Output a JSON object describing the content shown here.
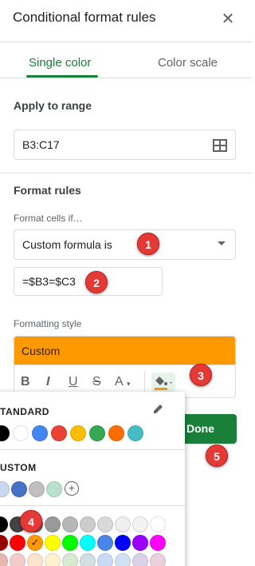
{
  "header": {
    "title": "Conditional format rules",
    "close_icon": "close-icon"
  },
  "tabs": [
    {
      "label": "Single color",
      "active": true
    },
    {
      "label": "Color scale",
      "active": false
    }
  ],
  "range": {
    "label": "Apply to range",
    "value": "B3:C17",
    "icon": "grid-icon"
  },
  "rules": {
    "label": "Format rules",
    "condition_label": "Format cells if…",
    "condition_value": "Custom formula is",
    "formula_value": "=$B3=$C3"
  },
  "style": {
    "label": "Formatting style",
    "preset": "Custom",
    "fill_color": "#ff9900",
    "toolbar": {
      "bold": "B",
      "italic": "I",
      "underline": "U",
      "strike": "S",
      "text_color": "A"
    }
  },
  "done_label": "Done",
  "palette": {
    "standard_label": "TANDARD",
    "custom_label": "USTOM",
    "standard_colors": [
      "#000000",
      "#ffffff",
      "#4285f4",
      "#ea4335",
      "#fbbc04",
      "#34a853",
      "#ff6d01",
      "#46bdc6"
    ],
    "custom_colors": [
      "#c9d7f0",
      "#4472c4",
      "#bfbfbf",
      "#b7e1cd"
    ],
    "grid_row1": [
      "#000000",
      "#434343",
      "#666666",
      "#999999",
      "#b7b7b7",
      "#cccccc",
      "#d9d9d9",
      "#efefef",
      "#f3f3f3",
      "#ffffff"
    ],
    "grid_row2": [
      "#980000",
      "#ff0000",
      "#ff9900",
      "#ffff00",
      "#00ff00",
      "#00ffff",
      "#4a86e8",
      "#0000ff",
      "#9900ff",
      "#ff00ff"
    ],
    "grid_row3": [
      "#e6b8af",
      "#f4cccc",
      "#fce5cd",
      "#fff2cc",
      "#d9ead3",
      "#d0e0e3",
      "#c9daf8",
      "#cfe2f3",
      "#d9d2e9",
      "#ead1dc"
    ]
  },
  "callouts": [
    "1",
    "2",
    "3",
    "4",
    "5"
  ]
}
